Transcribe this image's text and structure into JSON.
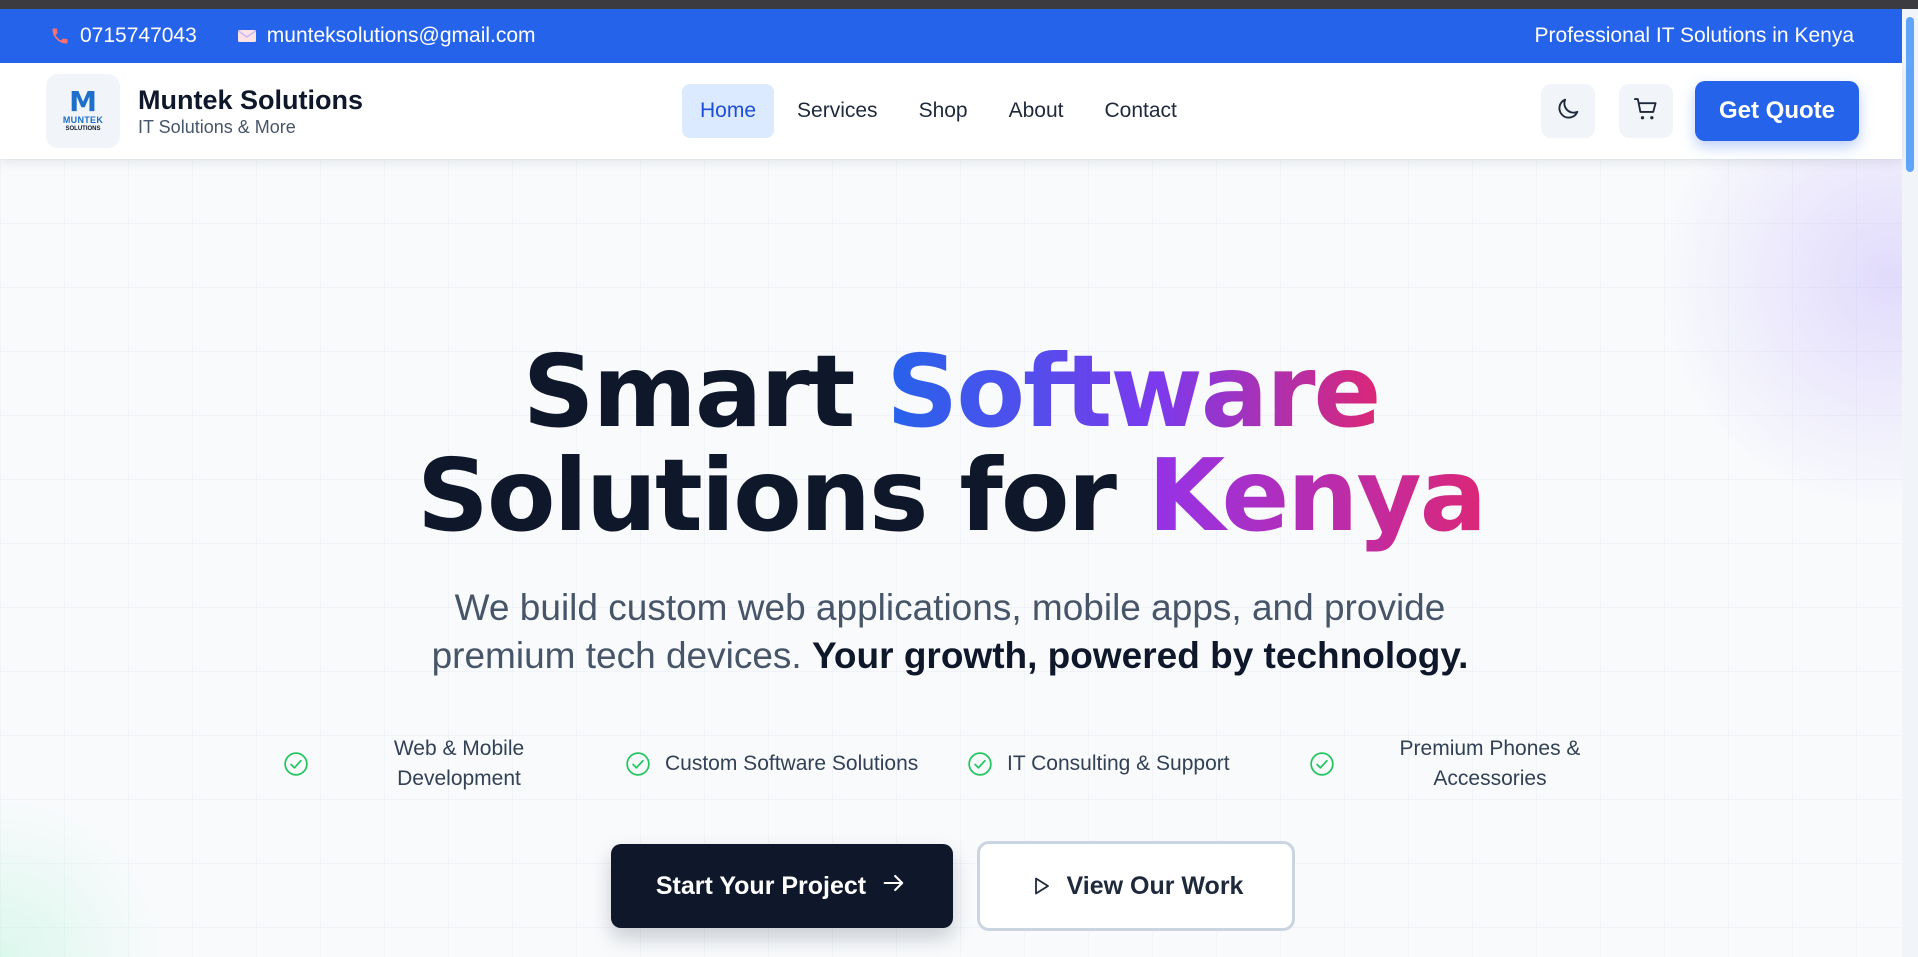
{
  "topbar": {
    "phone": "0715747043",
    "email": "munteksolutions@gmail.com",
    "tagline": "Professional IT Solutions in Kenya",
    "background": "#2563eb"
  },
  "header": {
    "logo_mark": "M",
    "logo_word": "MUNTEK",
    "logo_sub": "SOLUTIONS",
    "brand_name": "Muntek Solutions",
    "brand_tagline": "IT Solutions & More",
    "nav": [
      {
        "label": "Home",
        "active": true
      },
      {
        "label": "Services",
        "active": false
      },
      {
        "label": "Shop",
        "active": false
      },
      {
        "label": "About",
        "active": false
      },
      {
        "label": "Contact",
        "active": false
      }
    ],
    "theme_toggle_icon": "moon-icon",
    "cart_icon": "cart-icon",
    "quote_button": "Get Quote"
  },
  "hero": {
    "headline": {
      "word1": "Smart",
      "word2": "Software",
      "word3": "Solutions for",
      "word4": "Kenya"
    },
    "subtitle_plain": "We build custom web applications, mobile apps, and provide premium tech devices.",
    "subtitle_bold": "Your growth, powered by technology.",
    "features": [
      "Web & Mobile Development",
      "Custom Software Solutions",
      "IT Consulting & Support",
      "Premium Phones & Accessories"
    ],
    "primary_cta": "Start Your Project",
    "secondary_cta": "View Our Work"
  },
  "colors": {
    "accent": "#2563eb",
    "dark": "#0f172a",
    "gradient_start": "#2563eb",
    "gradient_mid": "#7c3aed",
    "gradient_end": "#db2777",
    "check": "#22c55e"
  }
}
